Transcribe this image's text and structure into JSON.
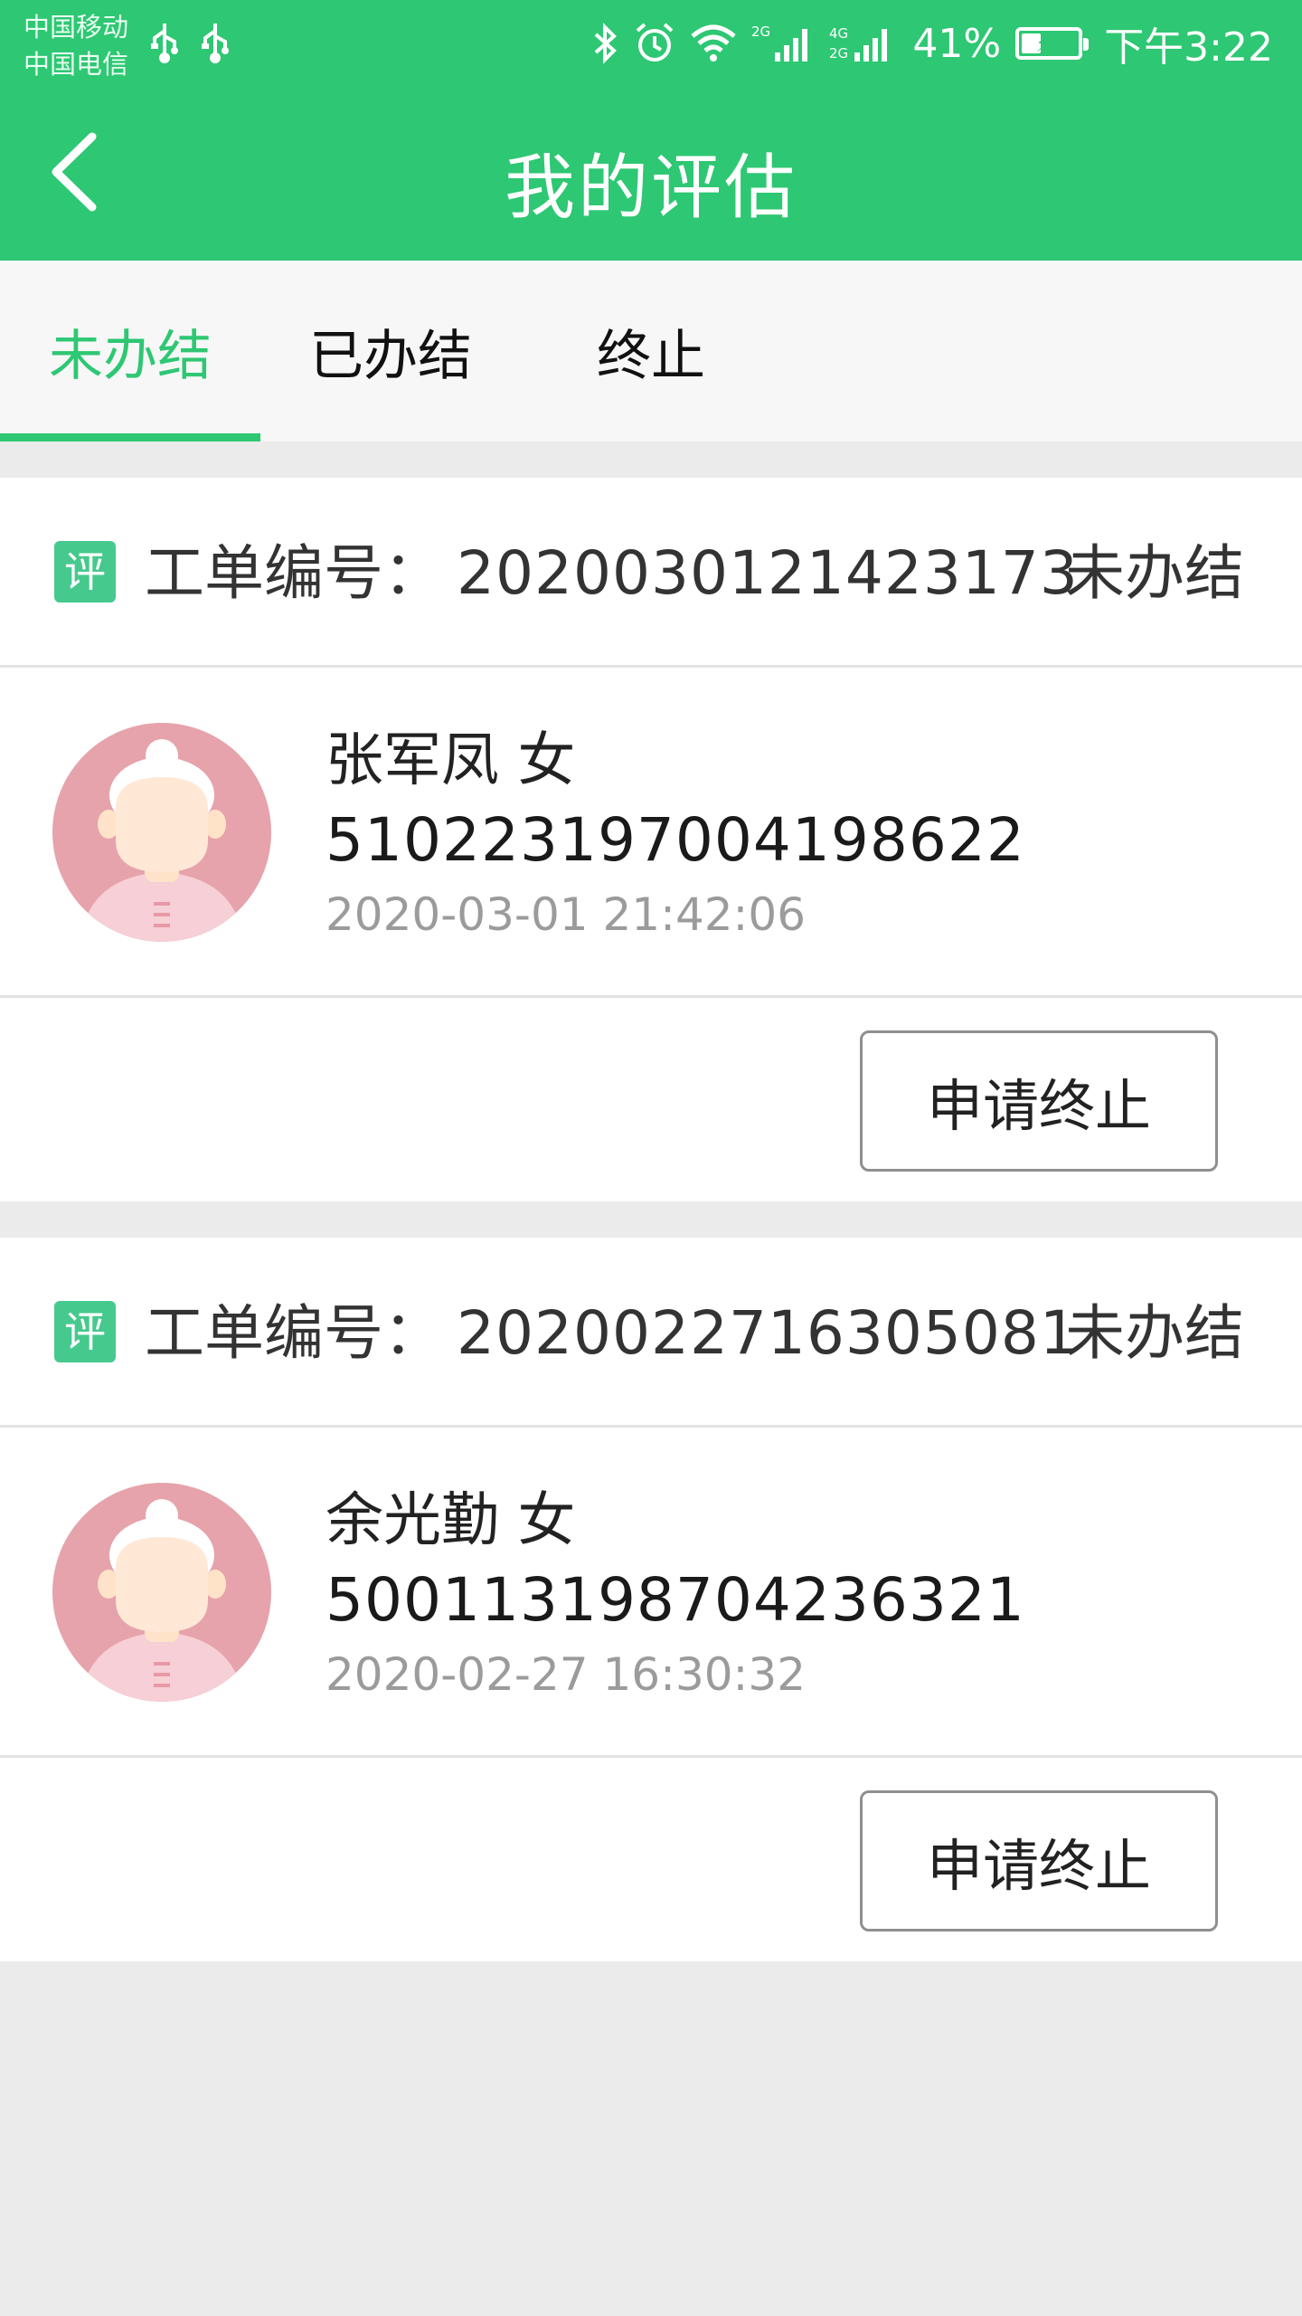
{
  "status_bar": {
    "carrier1": "中国移动",
    "carrier2": "中国电信",
    "battery_percent": "41%",
    "battery_level": 0.41,
    "time": "下午3:22",
    "net1": "2G",
    "net2": "4G",
    "net3": "2G"
  },
  "header": {
    "title": "我的评估"
  },
  "tabs": [
    {
      "label": "未办结",
      "active": true
    },
    {
      "label": "已办结",
      "active": false
    },
    {
      "label": "终止",
      "active": false
    }
  ],
  "orders": [
    {
      "badge": "评",
      "order_label": "工单编号：",
      "order_no": "2020030121423173",
      "status": "未办结",
      "name_gender": "张军凤  女",
      "id_number": "510223197004198622",
      "time": "2020-03-01 21:42:06",
      "action_label": "申请终止"
    },
    {
      "badge": "评",
      "order_label": "工单编号：",
      "order_no": "2020022716305081",
      "status": "未办结",
      "name_gender": "余光勤  女",
      "id_number": "500113198704236321",
      "time": "2020-02-27 16:30:32",
      "action_label": "申请终止"
    }
  ],
  "colors": {
    "brand_green": "#2ec773",
    "badge_green": "#46c98d",
    "background": "#ebebeb"
  }
}
